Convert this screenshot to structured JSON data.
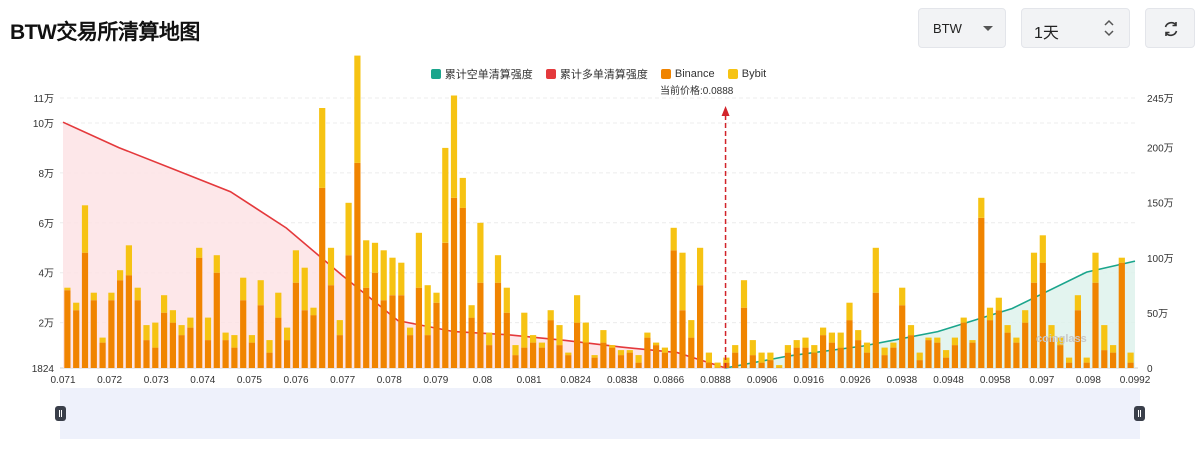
{
  "page": {
    "title": "BTW交易所清算地图",
    "coin_select": "BTW",
    "time_select": "1天",
    "refresh_icon": "refresh-icon",
    "watermark": "coinglass"
  },
  "colors": {
    "short": "#1aa58c",
    "long": "#e4393c",
    "binance": "#f08400",
    "bybit": "#f6c313",
    "long_fill": "#fde3e5",
    "short_fill": "#def2ec"
  },
  "chart_data": {
    "type": "bar",
    "current_price_label": "当前价格:0.0888",
    "current_price": 0.0888,
    "legend": [
      "累计空单清算强度",
      "累计多单清算强度",
      "Binance",
      "Bybit"
    ],
    "y_left_ticks": [
      "11万",
      "10万",
      "8万",
      "6万",
      "4万",
      "2万",
      "1824"
    ],
    "y_left_range": [
      1824,
      110000
    ],
    "y_right_ticks": [
      "245万",
      "200万",
      "150万",
      "100万",
      "50万",
      "0"
    ],
    "y_right_range": [
      0,
      2450000
    ],
    "x_tick_labels": [
      "0.071",
      "0.072",
      "0.073",
      "0.074",
      "0.075",
      "0.076",
      "0.077",
      "0.078",
      "0.079",
      "0.08",
      "0.081",
      "0.0824",
      "0.0838",
      "0.0866",
      "0.0888",
      "0.0906",
      "0.0916",
      "0.0926",
      "0.0938",
      "0.0948",
      "0.0958",
      "0.097",
      "0.098",
      "0.0992"
    ],
    "series": [
      {
        "name": "Binance",
        "values": [
          33000,
          25000,
          48000,
          29000,
          12000,
          29000,
          37000,
          39000,
          29000,
          13000,
          10000,
          24000,
          20000,
          15000,
          18000,
          46000,
          13000,
          40000,
          13000,
          10000,
          29000,
          12000,
          27000,
          8000,
          22000,
          13000,
          36000,
          25000,
          23000,
          74000,
          35000,
          15000,
          47000,
          84000,
          34000,
          40000,
          29000,
          31000,
          31000,
          15000,
          34000,
          15000,
          28000,
          52000,
          70000,
          66000,
          22000,
          36000,
          11000,
          36000,
          24000,
          7000,
          10000,
          12000,
          10000,
          21000,
          11000,
          7000,
          20000,
          12000,
          6000,
          12000,
          10000,
          7000,
          8000,
          4000,
          14000,
          11000,
          8000,
          49000,
          25000,
          14000,
          35000,
          4000,
          2000,
          4000,
          8000,
          26000,
          7000,
          4000,
          5000,
          2000,
          8000,
          10000,
          10000,
          8000,
          15000,
          12000,
          10000,
          21000,
          13000,
          8000,
          32000,
          7000,
          10000,
          27000,
          15000,
          5000,
          13000,
          12000,
          6000,
          11000,
          20000,
          12000,
          62000,
          21000,
          25000,
          16000,
          12000,
          20000,
          36000,
          44000,
          14000,
          11000,
          4000,
          25000,
          4000,
          36000,
          9000,
          8000,
          44000,
          4000
        ]
      },
      {
        "name": "Bybit",
        "values": [
          1000,
          3000,
          19000,
          3000,
          2000,
          3000,
          4000,
          12000,
          5000,
          6000,
          10000,
          7000,
          5000,
          4000,
          4000,
          4000,
          9000,
          7000,
          3000,
          5000,
          9000,
          3000,
          10000,
          5000,
          10000,
          5000,
          13000,
          17000,
          3000,
          32000,
          15000,
          6000,
          21000,
          43000,
          19000,
          12000,
          20000,
          15000,
          13000,
          3000,
          22000,
          20000,
          4000,
          38000,
          41000,
          12000,
          5000,
          24000,
          5000,
          11000,
          10000,
          4000,
          14000,
          3000,
          2000,
          4000,
          8000,
          1000,
          11000,
          8000,
          1000,
          5000,
          1000,
          2000,
          1000,
          3000,
          2000,
          1000,
          2000,
          9000,
          23000,
          7000,
          15000,
          4000,
          2000,
          2000,
          3000,
          11000,
          6000,
          4000,
          3000,
          1000,
          3000,
          3000,
          4000,
          3000,
          3000,
          4000,
          6000,
          7000,
          4000,
          4000,
          18000,
          3000,
          2000,
          7000,
          4000,
          3000,
          1000,
          2000,
          3000,
          3000,
          2000,
          1000,
          8000,
          5000,
          5000,
          3000,
          2000,
          5000,
          12000,
          11000,
          5000,
          3000,
          2000,
          6000,
          2000,
          12000,
          10000,
          3000,
          2000,
          4000
        ]
      },
      {
        "name": "累计多单清算强度",
        "x": [
          0.071,
          0.0725,
          0.074,
          0.0755,
          0.077,
          0.0785,
          0.08,
          0.0815,
          0.083,
          0.0845,
          0.086,
          0.0875,
          0.0888
        ],
        "values": [
          2230000,
          2000000,
          1800000,
          1600000,
          1270000,
          840000,
          430000,
          330000,
          300000,
          250000,
          190000,
          140000,
          0
        ]
      },
      {
        "name": "累计空单清算强度",
        "x": [
          0.0888,
          0.0905,
          0.0925,
          0.0945,
          0.0965,
          0.0985,
          0.0998
        ],
        "values": [
          0,
          110000,
          200000,
          330000,
          540000,
          870000,
          970000
        ]
      }
    ]
  }
}
